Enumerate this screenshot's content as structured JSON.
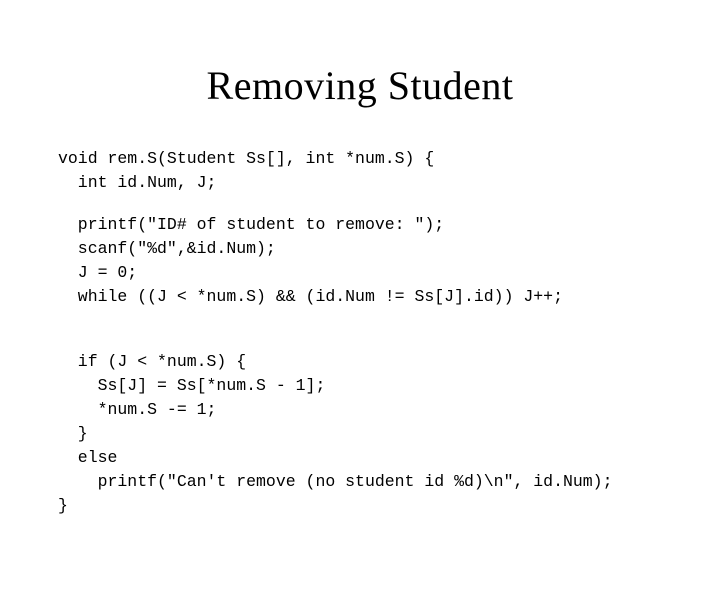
{
  "title": "Removing Student",
  "code": {
    "line1": "void rem.S(Student Ss[], int *num.S) {",
    "line2": "  int id.Num, J;",
    "line3": "  printf(\"ID# of student to remove: \");",
    "line4": "  scanf(\"%d\",&id.Num);",
    "line5": "  J = 0;",
    "line6": "  while ((J < *num.S) && (id.Num != Ss[J].id)) J++;",
    "line7": "  if (J < *num.S) {",
    "line8": "    Ss[J] = Ss[*num.S - 1];",
    "line9": "    *num.S -= 1;",
    "line10": "  }",
    "line11": "  else",
    "line12": "    printf(\"Can't remove (no student id %d)\\n\", id.Num);",
    "line13": "}"
  }
}
